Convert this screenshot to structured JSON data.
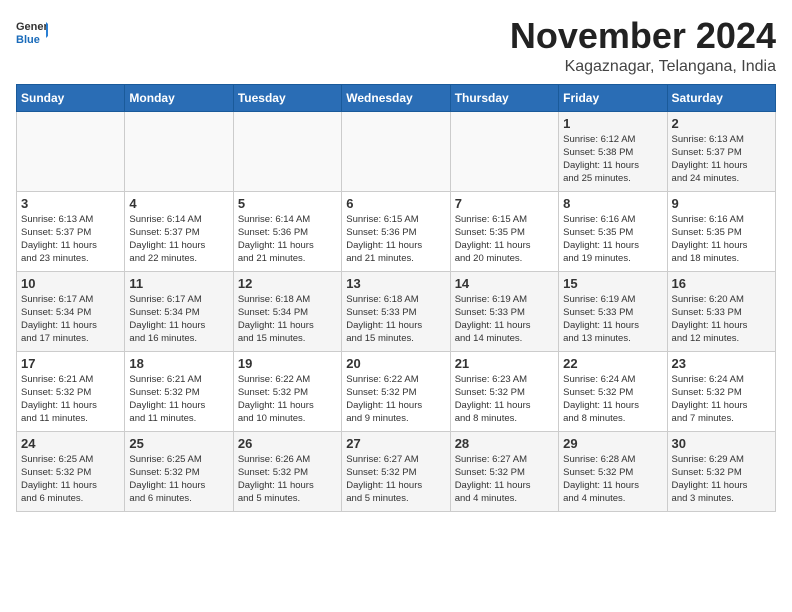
{
  "logo": {
    "text_general": "General",
    "text_blue": "Blue"
  },
  "title": "November 2024",
  "location": "Kagaznagar, Telangana, India",
  "weekdays": [
    "Sunday",
    "Monday",
    "Tuesday",
    "Wednesday",
    "Thursday",
    "Friday",
    "Saturday"
  ],
  "weeks": [
    [
      {
        "day": "",
        "info": ""
      },
      {
        "day": "",
        "info": ""
      },
      {
        "day": "",
        "info": ""
      },
      {
        "day": "",
        "info": ""
      },
      {
        "day": "",
        "info": ""
      },
      {
        "day": "1",
        "info": "Sunrise: 6:12 AM\nSunset: 5:38 PM\nDaylight: 11 hours\nand 25 minutes."
      },
      {
        "day": "2",
        "info": "Sunrise: 6:13 AM\nSunset: 5:37 PM\nDaylight: 11 hours\nand 24 minutes."
      }
    ],
    [
      {
        "day": "3",
        "info": "Sunrise: 6:13 AM\nSunset: 5:37 PM\nDaylight: 11 hours\nand 23 minutes."
      },
      {
        "day": "4",
        "info": "Sunrise: 6:14 AM\nSunset: 5:37 PM\nDaylight: 11 hours\nand 22 minutes."
      },
      {
        "day": "5",
        "info": "Sunrise: 6:14 AM\nSunset: 5:36 PM\nDaylight: 11 hours\nand 21 minutes."
      },
      {
        "day": "6",
        "info": "Sunrise: 6:15 AM\nSunset: 5:36 PM\nDaylight: 11 hours\nand 21 minutes."
      },
      {
        "day": "7",
        "info": "Sunrise: 6:15 AM\nSunset: 5:35 PM\nDaylight: 11 hours\nand 20 minutes."
      },
      {
        "day": "8",
        "info": "Sunrise: 6:16 AM\nSunset: 5:35 PM\nDaylight: 11 hours\nand 19 minutes."
      },
      {
        "day": "9",
        "info": "Sunrise: 6:16 AM\nSunset: 5:35 PM\nDaylight: 11 hours\nand 18 minutes."
      }
    ],
    [
      {
        "day": "10",
        "info": "Sunrise: 6:17 AM\nSunset: 5:34 PM\nDaylight: 11 hours\nand 17 minutes."
      },
      {
        "day": "11",
        "info": "Sunrise: 6:17 AM\nSunset: 5:34 PM\nDaylight: 11 hours\nand 16 minutes."
      },
      {
        "day": "12",
        "info": "Sunrise: 6:18 AM\nSunset: 5:34 PM\nDaylight: 11 hours\nand 15 minutes."
      },
      {
        "day": "13",
        "info": "Sunrise: 6:18 AM\nSunset: 5:33 PM\nDaylight: 11 hours\nand 15 minutes."
      },
      {
        "day": "14",
        "info": "Sunrise: 6:19 AM\nSunset: 5:33 PM\nDaylight: 11 hours\nand 14 minutes."
      },
      {
        "day": "15",
        "info": "Sunrise: 6:19 AM\nSunset: 5:33 PM\nDaylight: 11 hours\nand 13 minutes."
      },
      {
        "day": "16",
        "info": "Sunrise: 6:20 AM\nSunset: 5:33 PM\nDaylight: 11 hours\nand 12 minutes."
      }
    ],
    [
      {
        "day": "17",
        "info": "Sunrise: 6:21 AM\nSunset: 5:32 PM\nDaylight: 11 hours\nand 11 minutes."
      },
      {
        "day": "18",
        "info": "Sunrise: 6:21 AM\nSunset: 5:32 PM\nDaylight: 11 hours\nand 11 minutes."
      },
      {
        "day": "19",
        "info": "Sunrise: 6:22 AM\nSunset: 5:32 PM\nDaylight: 11 hours\nand 10 minutes."
      },
      {
        "day": "20",
        "info": "Sunrise: 6:22 AM\nSunset: 5:32 PM\nDaylight: 11 hours\nand 9 minutes."
      },
      {
        "day": "21",
        "info": "Sunrise: 6:23 AM\nSunset: 5:32 PM\nDaylight: 11 hours\nand 8 minutes."
      },
      {
        "day": "22",
        "info": "Sunrise: 6:24 AM\nSunset: 5:32 PM\nDaylight: 11 hours\nand 8 minutes."
      },
      {
        "day": "23",
        "info": "Sunrise: 6:24 AM\nSunset: 5:32 PM\nDaylight: 11 hours\nand 7 minutes."
      }
    ],
    [
      {
        "day": "24",
        "info": "Sunrise: 6:25 AM\nSunset: 5:32 PM\nDaylight: 11 hours\nand 6 minutes."
      },
      {
        "day": "25",
        "info": "Sunrise: 6:25 AM\nSunset: 5:32 PM\nDaylight: 11 hours\nand 6 minutes."
      },
      {
        "day": "26",
        "info": "Sunrise: 6:26 AM\nSunset: 5:32 PM\nDaylight: 11 hours\nand 5 minutes."
      },
      {
        "day": "27",
        "info": "Sunrise: 6:27 AM\nSunset: 5:32 PM\nDaylight: 11 hours\nand 5 minutes."
      },
      {
        "day": "28",
        "info": "Sunrise: 6:27 AM\nSunset: 5:32 PM\nDaylight: 11 hours\nand 4 minutes."
      },
      {
        "day": "29",
        "info": "Sunrise: 6:28 AM\nSunset: 5:32 PM\nDaylight: 11 hours\nand 4 minutes."
      },
      {
        "day": "30",
        "info": "Sunrise: 6:29 AM\nSunset: 5:32 PM\nDaylight: 11 hours\nand 3 minutes."
      }
    ]
  ]
}
